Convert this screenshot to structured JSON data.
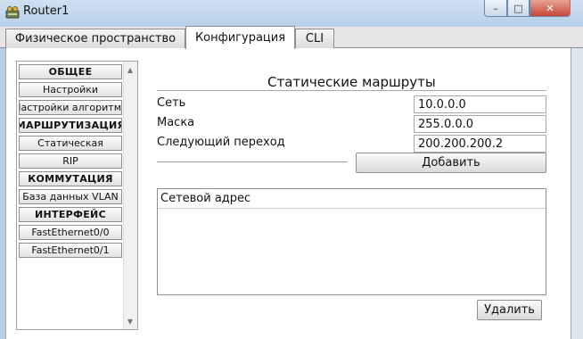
{
  "window": {
    "title": "Router1",
    "controls": {
      "minimize": "–",
      "maximize": "□",
      "close": "✕"
    }
  },
  "tabs": [
    {
      "label": "Физическое пространство",
      "active": false
    },
    {
      "label": "Конфигурация",
      "active": true
    },
    {
      "label": "CLI",
      "active": false
    }
  ],
  "sidebar": {
    "items": [
      {
        "label": "ОБЩЕЕ",
        "type": "header"
      },
      {
        "label": "Настройки",
        "type": "item"
      },
      {
        "label": "Настройки алгоритма",
        "type": "item"
      },
      {
        "label": "МАРШРУТИЗАЦИЯ",
        "type": "header"
      },
      {
        "label": "Статическая",
        "type": "item"
      },
      {
        "label": "RIP",
        "type": "item"
      },
      {
        "label": "КОММУТАЦИЯ",
        "type": "header"
      },
      {
        "label": "База данных VLAN",
        "type": "item"
      },
      {
        "label": "ИНТЕРФЕЙС",
        "type": "header"
      },
      {
        "label": "FastEthernet0/0",
        "type": "item"
      },
      {
        "label": "FastEthernet0/1",
        "type": "item"
      }
    ],
    "scroll_up": "▲",
    "scroll_down": "▼"
  },
  "main": {
    "title": "Статические маршруты",
    "fields": [
      {
        "label": "Сеть",
        "value": "10.0.0.0"
      },
      {
        "label": "Маска",
        "value": "255.0.0.0"
      },
      {
        "label": "Следующий переход",
        "value": "200.200.200.2"
      }
    ],
    "add_button": "Добавить",
    "list_header": "Сетевой адрес",
    "delete_button": "Удалить"
  }
}
